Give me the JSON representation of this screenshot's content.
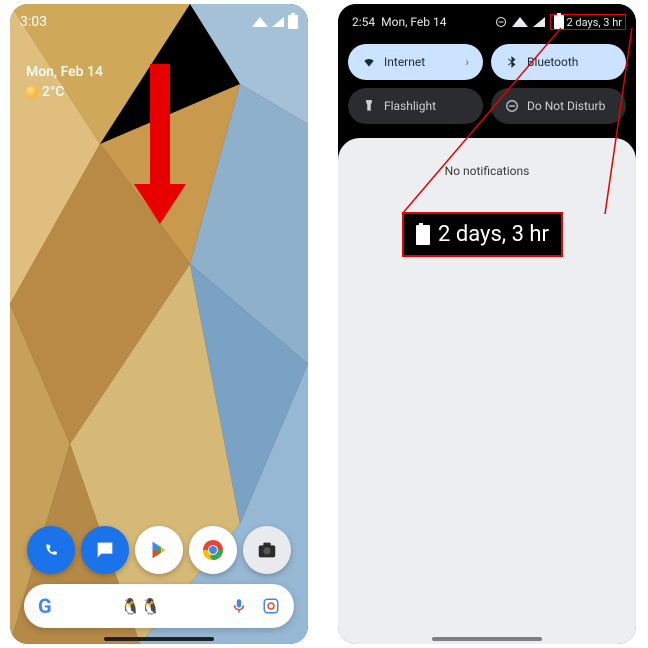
{
  "left": {
    "time": "3:03",
    "date": "Mon, Feb 14",
    "temp": "2°C"
  },
  "right": {
    "time": "2:54",
    "date": "Mon, Feb 14",
    "battery_estimate": "2 days, 3 hr",
    "tiles": {
      "internet": "Internet",
      "bluetooth": "Bluetooth",
      "flashlight": "Flashlight",
      "dnd": "Do Not Disturb"
    },
    "no_notifications": "No notifications"
  },
  "callout": "2 days, 3 hr"
}
